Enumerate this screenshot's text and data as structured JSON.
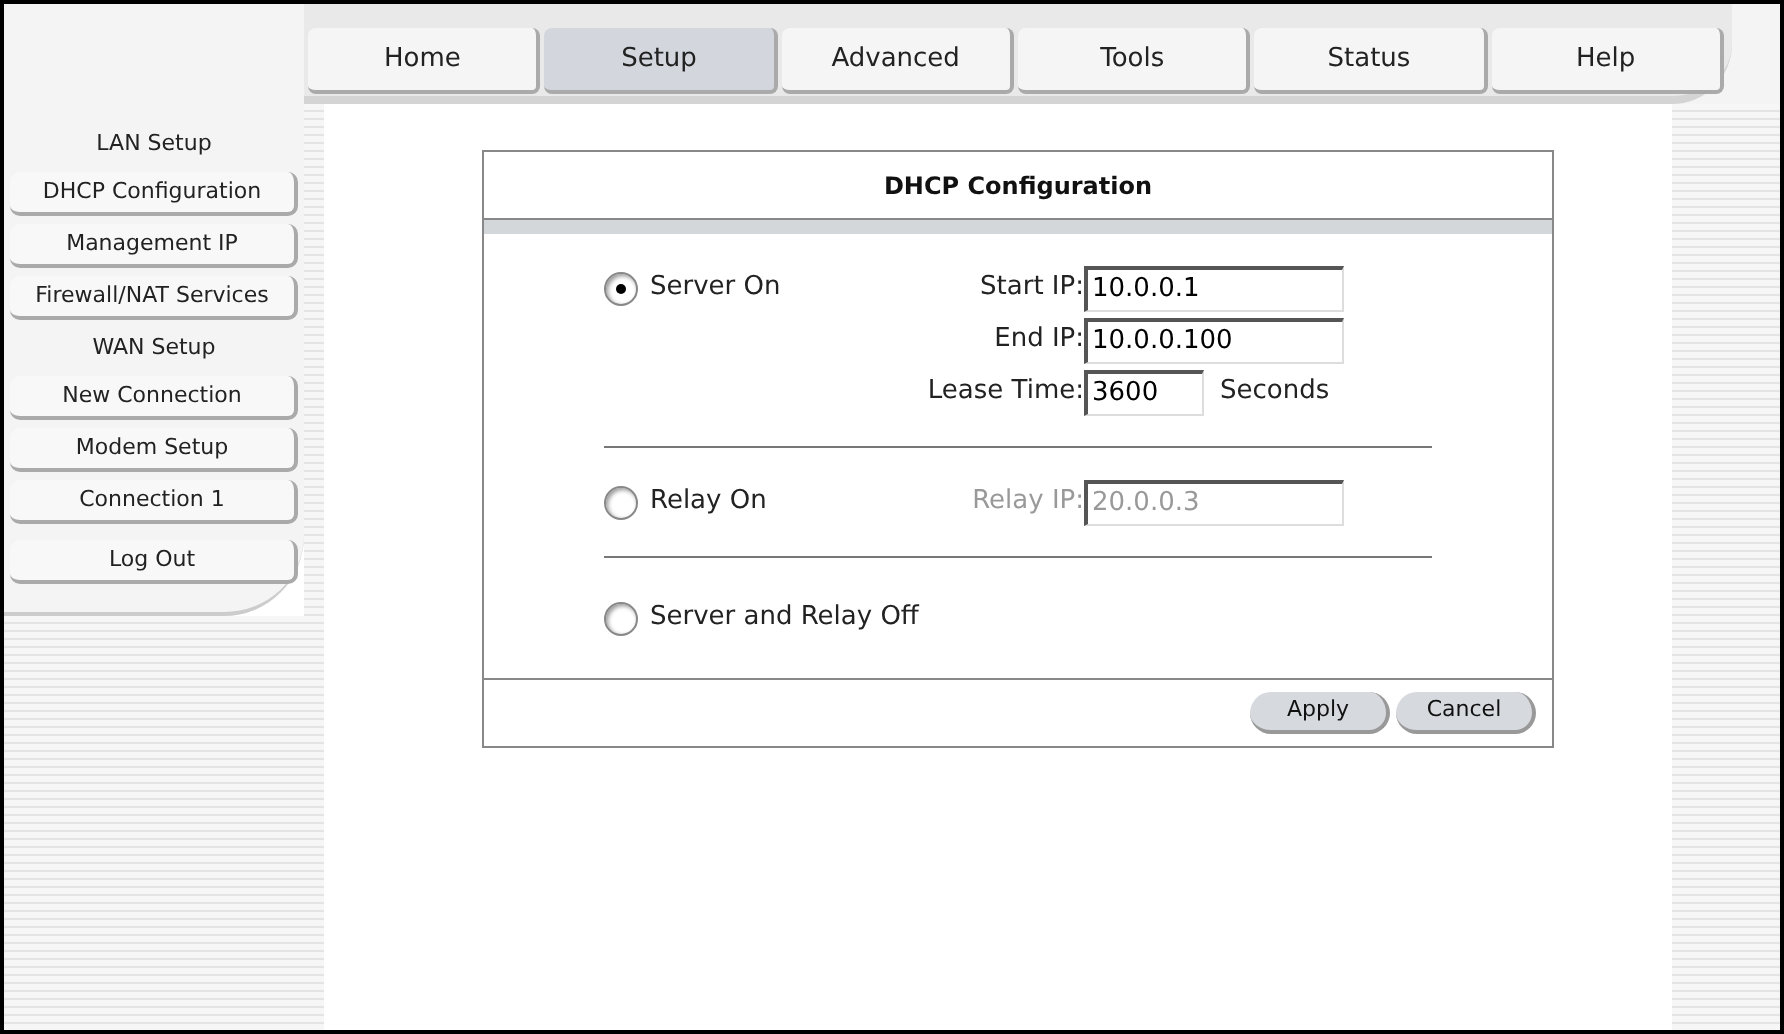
{
  "tabs": [
    {
      "label": "Home",
      "selected": false
    },
    {
      "label": "Setup",
      "selected": true
    },
    {
      "label": "Advanced",
      "selected": false
    },
    {
      "label": "Tools",
      "selected": false
    },
    {
      "label": "Status",
      "selected": false
    },
    {
      "label": "Help",
      "selected": false
    }
  ],
  "sidebar": {
    "items": [
      {
        "kind": "heading",
        "label": "LAN Setup"
      },
      {
        "kind": "button",
        "label": "DHCP Configuration"
      },
      {
        "kind": "button",
        "label": "Management IP"
      },
      {
        "kind": "button",
        "label": "Firewall/NAT Services"
      },
      {
        "kind": "heading",
        "label": "WAN Setup"
      },
      {
        "kind": "button",
        "label": "New Connection"
      },
      {
        "kind": "button",
        "label": "Modem Setup"
      },
      {
        "kind": "button",
        "label": "Connection 1"
      },
      {
        "kind": "logout",
        "label": "Log Out"
      }
    ]
  },
  "panel": {
    "title": "DHCP Configuration",
    "options": [
      {
        "label": "Server On",
        "selected": true,
        "fields": [
          {
            "label": "Start IP:",
            "value": "10.0.0.1",
            "disabled": false
          },
          {
            "label": "End IP:",
            "value": "10.0.0.100",
            "disabled": false
          },
          {
            "label": "Lease Time:",
            "value": "3600",
            "disabled": false,
            "unit": "Seconds"
          }
        ]
      },
      {
        "label": "Relay On",
        "selected": false,
        "fields": [
          {
            "label": "Relay IP:",
            "value": "20.0.0.3",
            "disabled": true
          }
        ]
      },
      {
        "label": "Server and Relay Off",
        "selected": false
      }
    ],
    "buttons": [
      "Apply",
      "Cancel"
    ]
  }
}
